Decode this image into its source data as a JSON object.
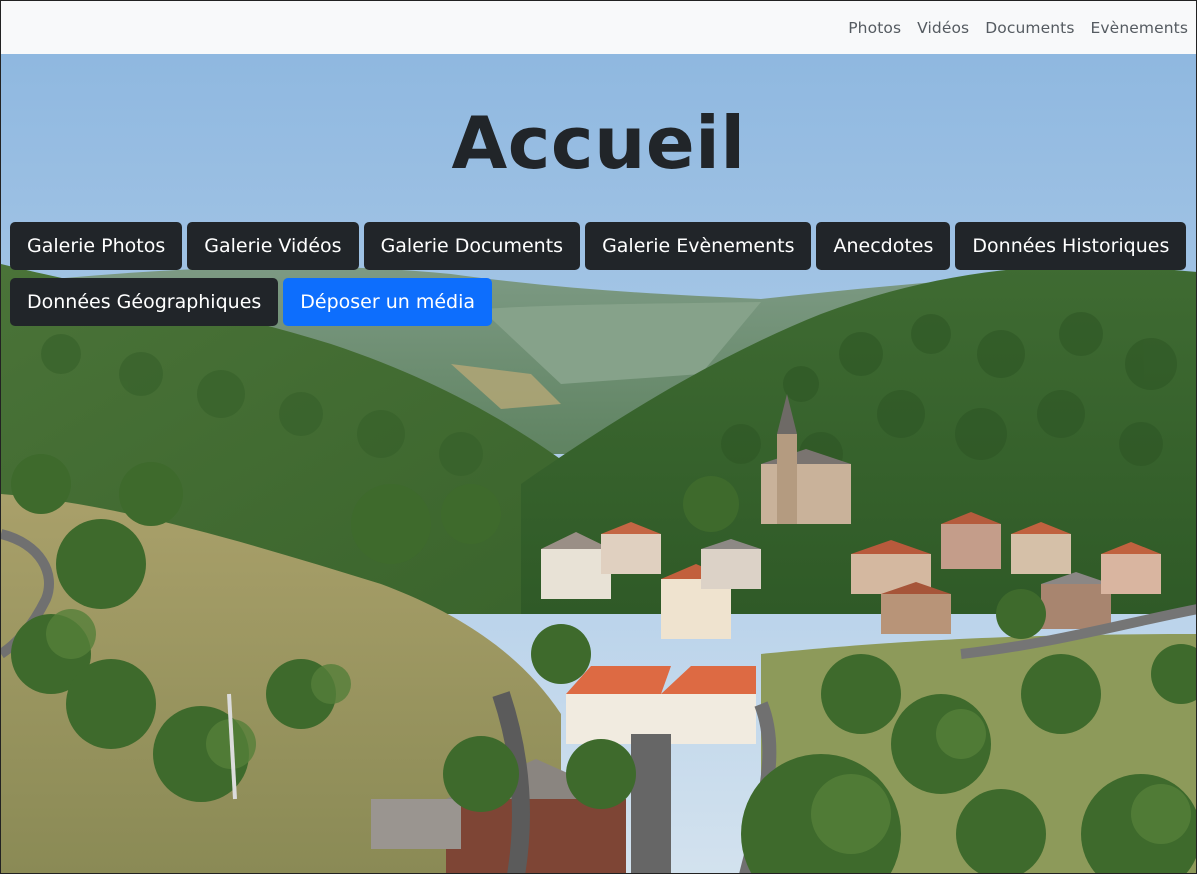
{
  "navbar": {
    "links": [
      "Photos",
      "Vidéos",
      "Documents",
      "Evènements"
    ]
  },
  "hero": {
    "title": "Accueil",
    "buttons_row1": [
      "Galerie Photos",
      "Galerie Vidéos",
      "Galerie Documents",
      "Galerie Evènements",
      "Anecdotes",
      "Données Historiques"
    ],
    "buttons_row2": [
      "Données Géographiques"
    ],
    "primary_button": "Déposer un média",
    "background": "aerial-village-landscape-image"
  },
  "colors": {
    "navbar_bg": "#f8f9fa",
    "button_dark": "#212529",
    "button_primary": "#0d6efd",
    "title": "#212529"
  }
}
